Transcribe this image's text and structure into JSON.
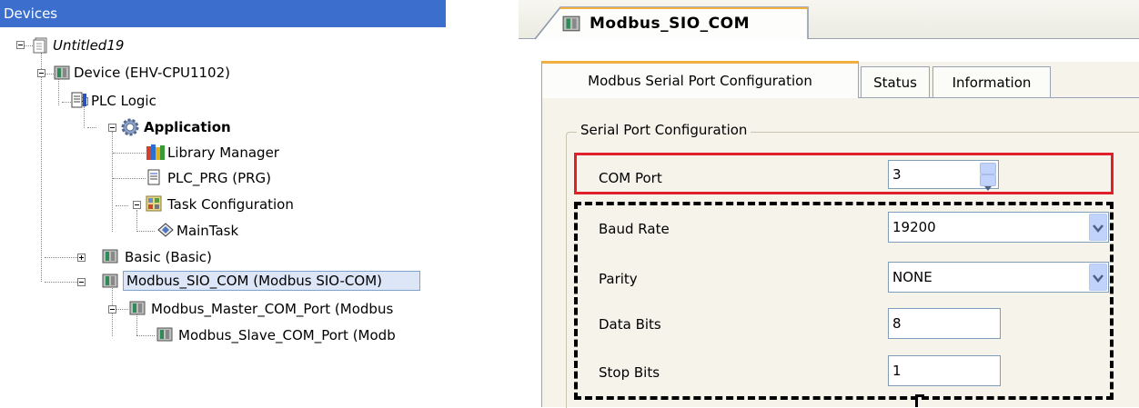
{
  "devices": {
    "header": "Devices",
    "tree": [
      {
        "label": "Untitled19",
        "icon": "project-icon"
      },
      {
        "label": "Device (EHV-CPU1102)",
        "icon": "device-icon"
      },
      {
        "label": "PLC Logic",
        "icon": "plc-logic-icon"
      },
      {
        "label": "Application",
        "icon": "application-gear-icon"
      },
      {
        "label": "Library Manager",
        "icon": "library-books-icon"
      },
      {
        "label": "PLC_PRG (PRG)",
        "icon": "document-icon"
      },
      {
        "label": "Task Configuration",
        "icon": "task-config-icon"
      },
      {
        "label": "MainTask",
        "icon": "task-icon"
      },
      {
        "label": "Basic (Basic)",
        "icon": "module-icon"
      },
      {
        "label": "Modbus_SIO_COM (Modbus SIO-COM)",
        "icon": "module-icon",
        "selected": true
      },
      {
        "label": "Modbus_Master_COM_Port (Modbus",
        "icon": "module-icon"
      },
      {
        "label": "Modbus_Slave_COM_Port (Modb",
        "icon": "module-icon"
      }
    ]
  },
  "config": {
    "title_tab": "Modbus_SIO_COM",
    "tabs": [
      "Modbus Serial Port Configuration",
      "Status",
      "Information"
    ],
    "group_title": "Serial Port Configuration",
    "com_port": {
      "label": "COM Port",
      "value": "3"
    },
    "baud_rate": {
      "label": "Baud Rate",
      "value": "19200"
    },
    "parity": {
      "label": "Parity",
      "value": "NONE"
    },
    "data_bits": {
      "label": "Data Bits",
      "value": "8"
    },
    "stop_bits": {
      "label": "Stop Bits",
      "value": "1"
    },
    "colors": {
      "highlight_red": "#e0202a",
      "dashed_black": "#000000",
      "header_blue": "#3c6fcd"
    }
  }
}
